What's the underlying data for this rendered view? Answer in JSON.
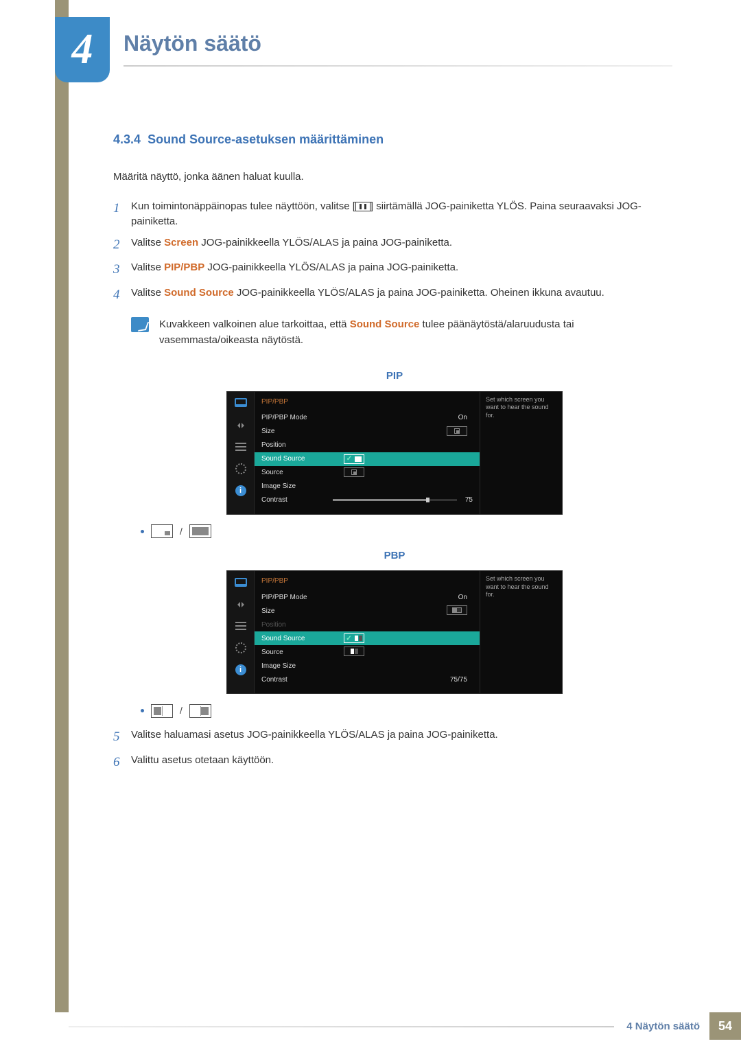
{
  "chapter": {
    "number": "4",
    "title": "Näytön säätö"
  },
  "section": {
    "number": "4.3.4",
    "title": "Sound Source-asetuksen määrittäminen"
  },
  "intro": "Määritä näyttö, jonka äänen haluat kuulla.",
  "steps": {
    "s1a": "Kun toimintonäppäinopas tulee näyttöön, valitse [",
    "s1b": "] siirtämällä JOG-painiketta YLÖS. Paina seuraavaksi JOG-painiketta.",
    "s2a": "Valitse ",
    "s2_hl": "Screen",
    "s2b": " JOG-painikkeella YLÖS/ALAS ja paina JOG-painiketta.",
    "s3a": "Valitse ",
    "s3_hl": "PIP/PBP",
    "s3b": " JOG-painikkeella YLÖS/ALAS ja paina JOG-painiketta.",
    "s4a": "Valitse ",
    "s4_hl": "Sound Source",
    "s4b": " JOG-painikkeella YLÖS/ALAS ja paina JOG-painiketta. Oheinen ikkuna avautuu.",
    "s5": "Valitse haluamasi asetus JOG-painikkeella YLÖS/ALAS ja paina JOG-painiketta.",
    "s6": "Valittu asetus otetaan käyttöön."
  },
  "note": {
    "pre": "Kuvakkeen valkoinen alue tarkoittaa, että ",
    "hl": "Sound Source",
    "post": " tulee päänäytöstä/alaruudusta tai vasemmasta/oikeasta näytöstä."
  },
  "captions": {
    "pip": "PIP",
    "pbp": "PBP"
  },
  "osd": {
    "title": "PIP/PBP",
    "help": "Set which screen you want to hear the sound for.",
    "rows": {
      "mode": "PIP/PBP Mode",
      "size": "Size",
      "position": "Position",
      "sound": "Sound Source",
      "source": "Source",
      "image": "Image Size",
      "contrast": "Contrast"
    },
    "vals": {
      "on": "On",
      "c75": "75",
      "c7575": "75/75"
    }
  },
  "bullet_sep": "/",
  "footer": {
    "text": "4 Näytön säätö",
    "page": "54"
  }
}
